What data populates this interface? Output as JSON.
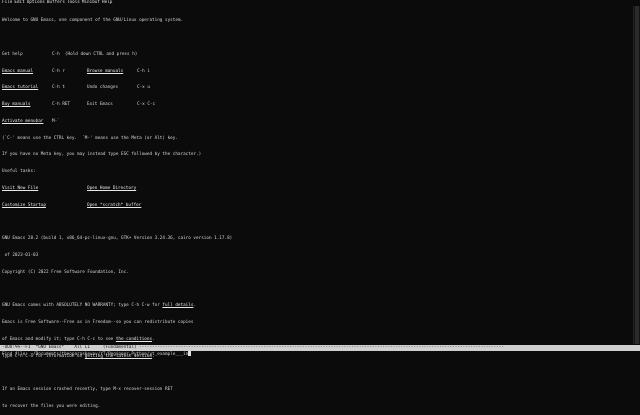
{
  "menu": [
    "File",
    "Edit",
    "Options",
    "Buffers",
    "Tools",
    "Minibuf",
    "Help"
  ],
  "buffer": {
    "welcome": "Welcome to GNU Emacs, one component of the GNU/Linux operating system.",
    "get_help_label": "Get help",
    "get_help_key": "C-h  (Hold down CTRL and press h)",
    "rows": [
      {
        "a": "Emacs manual",
        "ak": "C-h r",
        "b": "Browse manuals",
        "bk": "C-h i"
      },
      {
        "a": "Emacs tutorial",
        "ak": "C-h t",
        "b": "Undo changes",
        "bk": "C-x u"
      },
      {
        "a": "Buy manuals",
        "ak": "C-h RET",
        "b": "Exit Emacs",
        "bk": "C-x C-c"
      },
      {
        "a": "Activate menubar",
        "ak": "M-`",
        "b": "",
        "bk": ""
      }
    ],
    "ctrl_note": "(`C-' means use the CTRL key.  `M-' means use the Meta (or Alt) key.",
    "meta_note": "If you have no Meta key, you may instead type ESC followed by the character.)",
    "useful_tasks": "Useful tasks:",
    "tasks": [
      {
        "a": "Visit New File",
        "b": "Open Home Directory"
      },
      {
        "a": "Customize Startup",
        "b": "Open *scratch* buffer"
      }
    ],
    "version_line": "GNU Emacs 28.2 (build 1, x86_64-pc-linux-gnu, GTK+ Version 3.24.36, cairo version 1.17.8)",
    "version_date": " of 2023-01-03",
    "copyright": "Copyright (C) 2022 Free Software Foundation, Inc.",
    "warranty_pre": "GNU Emacs comes with ABSOLUTELY NO WARRANTY; type C-h C-w for ",
    "warranty_link": "full details",
    "warranty_post": ".",
    "free_line": "Emacs is Free Software--Free as in Freedom--so you can redistribute copies",
    "conditions_pre": "of Emacs and modify it; type C-h C-c to see ",
    "conditions_link": "the conditions",
    "conditions_post": ".",
    "info_pre": "Type C-h C-o for information on ",
    "info_link": "getting the latest version",
    "info_post": ".",
    "crash_1": "If an Emacs session crashed recently, type M-x recover-session RET",
    "crash_2": "to recover the files you were editing."
  },
  "modeline": "-UUU:%%--F1  *GNU Emacs*    All L1     (Fundamental) ---------------------------------------------------------------------------------------------------------------------------------------------",
  "minibuffer": {
    "prompt": "Find file: ",
    "value": "~/Documents/theoparaskevov/YT/Beginner_Python/yt_example___in"
  }
}
